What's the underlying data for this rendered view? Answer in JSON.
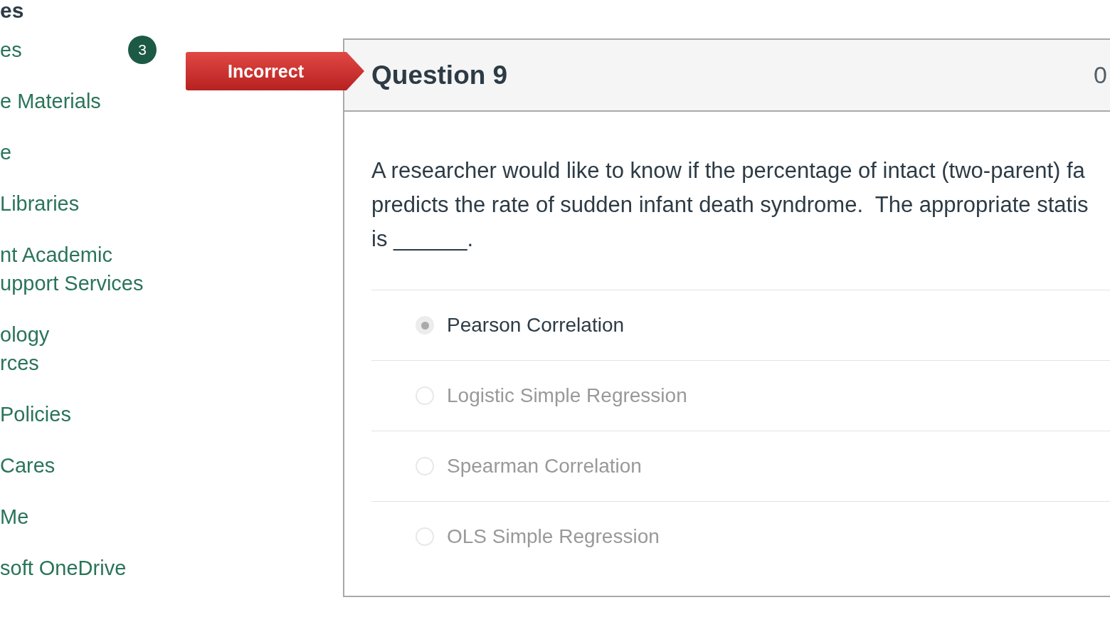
{
  "sidebar": {
    "heading": "es",
    "items": [
      {
        "lines": [
          "es"
        ],
        "badge": "3"
      },
      {
        "lines": [
          "e Materials"
        ]
      },
      {
        "lines": [
          "e"
        ]
      },
      {
        "lines": [
          "Libraries"
        ]
      },
      {
        "lines": [
          "nt Academic",
          "upport Services"
        ]
      },
      {
        "lines": [
          "ology",
          "rces"
        ]
      },
      {
        "lines": [
          "Policies"
        ]
      },
      {
        "lines": [
          "Cares"
        ]
      },
      {
        "lines": [
          "Me"
        ]
      },
      {
        "lines": [
          "soft OneDrive"
        ]
      }
    ]
  },
  "result_ribbon": {
    "label": "Incorrect",
    "kind": "incorrect"
  },
  "question": {
    "title": "Question 9",
    "points": "0",
    "text_lines": [
      "A researcher would like to know if the percentage of intact (two-parent) fa",
      "predicts the rate of sudden infant death syndrome.  The appropriate statis",
      "is ______."
    ],
    "answers": [
      {
        "label": "Pearson Correlation",
        "selected": true
      },
      {
        "label": "Logistic Simple Regression",
        "selected": false
      },
      {
        "label": "Spearman Correlation",
        "selected": false
      },
      {
        "label": "OLS Simple Regression",
        "selected": false
      }
    ]
  }
}
